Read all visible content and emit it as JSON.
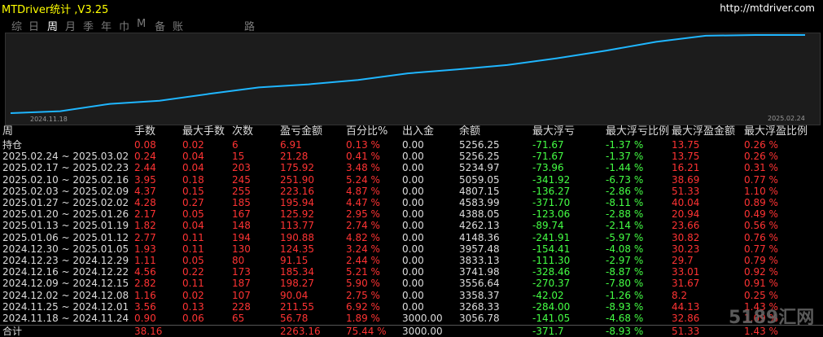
{
  "title": "MTDriver统计 ,V3.25",
  "site": "http://mtdriver.com",
  "tabs": [
    {
      "label": "综",
      "active": false
    },
    {
      "label": "日",
      "active": false
    },
    {
      "label": "周",
      "active": true
    },
    {
      "label": "月",
      "active": false
    },
    {
      "label": "季",
      "active": false
    },
    {
      "label": "年",
      "active": false
    },
    {
      "label": "巾",
      "active": false
    },
    {
      "label": "M",
      "active": false
    },
    {
      "label": "备",
      "active": false
    },
    {
      "label": "账户",
      "active": false
    },
    {
      "label": "路径",
      "active": false
    }
  ],
  "chart": {
    "x_start": "2024.11.18",
    "x_end": "2025.02.24",
    "line_color": "#1fb6ff",
    "values": [
      3000.0,
      3056.78,
      3268.33,
      3358.37,
      3556.64,
      3741.98,
      3833.13,
      3957.48,
      4148.36,
      4262.13,
      4388.05,
      4583.99,
      4807.15,
      5059.05,
      5234.97,
      5256.25,
      5256.25
    ]
  },
  "headers": [
    "周",
    "手数",
    "最大手数",
    "次数",
    "盈亏金额",
    "百分比%",
    "出入金",
    "余额",
    "最大浮亏",
    "最大浮亏比例",
    "最大浮盈金额",
    "最大浮盈比例"
  ],
  "rows": [
    [
      "持仓",
      "0.08",
      "0.02",
      "6",
      "6.91",
      "0.13 %",
      "0.00",
      "5256.25",
      "-71.67",
      "-1.37 %",
      "13.75",
      "0.26 %"
    ],
    [
      "2025.02.24 ~ 2025.03.02",
      "0.24",
      "0.04",
      "15",
      "21.28",
      "0.41 %",
      "0.00",
      "5256.25",
      "-71.67",
      "-1.37 %",
      "13.75",
      "0.26 %"
    ],
    [
      "2025.02.17 ~ 2025.02.23",
      "2.44",
      "0.04",
      "203",
      "175.92",
      "3.48 %",
      "0.00",
      "5234.97",
      "-73.96",
      "-1.44 %",
      "16.21",
      "0.31 %"
    ],
    [
      "2025.02.10 ~ 2025.02.16",
      "3.95",
      "0.18",
      "245",
      "251.90",
      "5.24 %",
      "0.00",
      "5059.05",
      "-341.92",
      "-6.73 %",
      "38.69",
      "0.77 %"
    ],
    [
      "2025.02.03 ~ 2025.02.09",
      "4.37",
      "0.15",
      "255",
      "223.16",
      "4.87 %",
      "0.00",
      "4807.15",
      "-136.27",
      "-2.86 %",
      "51.33",
      "1.10 %"
    ],
    [
      "2025.01.27 ~ 2025.02.02",
      "4.28",
      "0.27",
      "185",
      "195.94",
      "4.47 %",
      "0.00",
      "4583.99",
      "-371.70",
      "-8.11 %",
      "40.04",
      "0.89 %"
    ],
    [
      "2025.01.20 ~ 2025.01.26",
      "2.17",
      "0.05",
      "167",
      "125.92",
      "2.95 %",
      "0.00",
      "4388.05",
      "-123.06",
      "-2.88 %",
      "20.94",
      "0.49 %"
    ],
    [
      "2025.01.13 ~ 2025.01.19",
      "1.82",
      "0.04",
      "148",
      "113.77",
      "2.74 %",
      "0.00",
      "4262.13",
      "-89.74",
      "-2.14 %",
      "23.66",
      "0.56 %"
    ],
    [
      "2025.01.06 ~ 2025.01.12",
      "2.77",
      "0.11",
      "194",
      "190.88",
      "4.82 %",
      "0.00",
      "4148.36",
      "-241.91",
      "-5.97 %",
      "30.82",
      "0.76 %"
    ],
    [
      "2024.12.30 ~ 2025.01.05",
      "1.93",
      "0.11",
      "130",
      "124.35",
      "3.24 %",
      "0.00",
      "3957.48",
      "-154.41",
      "-4.08 %",
      "30.23",
      "0.77 %"
    ],
    [
      "2024.12.23 ~ 2024.12.29",
      "1.11",
      "0.05",
      "80",
      "91.15",
      "2.44 %",
      "0.00",
      "3833.13",
      "-111.30",
      "-2.97 %",
      "29.7",
      "0.79 %"
    ],
    [
      "2024.12.16 ~ 2024.12.22",
      "4.56",
      "0.22",
      "173",
      "185.34",
      "5.21 %",
      "0.00",
      "3741.98",
      "-328.46",
      "-8.87 %",
      "33.01",
      "0.92 %"
    ],
    [
      "2024.12.09 ~ 2024.12.15",
      "2.82",
      "0.11",
      "187",
      "198.27",
      "5.90 %",
      "0.00",
      "3556.64",
      "-270.37",
      "-7.80 %",
      "31.67",
      "0.91 %"
    ],
    [
      "2024.12.02 ~ 2024.12.08",
      "1.16",
      "0.02",
      "107",
      "90.04",
      "2.75 %",
      "0.00",
      "3358.37",
      "-42.02",
      "-1.26 %",
      "8.2",
      "0.25 %"
    ],
    [
      "2024.11.25 ~ 2024.12.01",
      "3.56",
      "0.13",
      "228",
      "211.55",
      "6.92 %",
      "0.00",
      "3268.33",
      "-284.00",
      "-8.93 %",
      "44.13",
      "1.43 %"
    ],
    [
      "2024.11.18 ~ 2024.11.24",
      "0.90",
      "0.06",
      "65",
      "56.78",
      "1.89 %",
      "3000.00",
      "3056.78",
      "-141.05",
      "-4.68 %",
      "32.86",
      "1.09 %"
    ]
  ],
  "total": [
    "合计",
    "38.16",
    "",
    "",
    "2263.16",
    "75.44 %",
    "3000.00",
    "",
    "-371.7",
    "-8.93 %",
    "51.33",
    "1.43 %"
  ],
  "watermark": "5189汇网"
}
